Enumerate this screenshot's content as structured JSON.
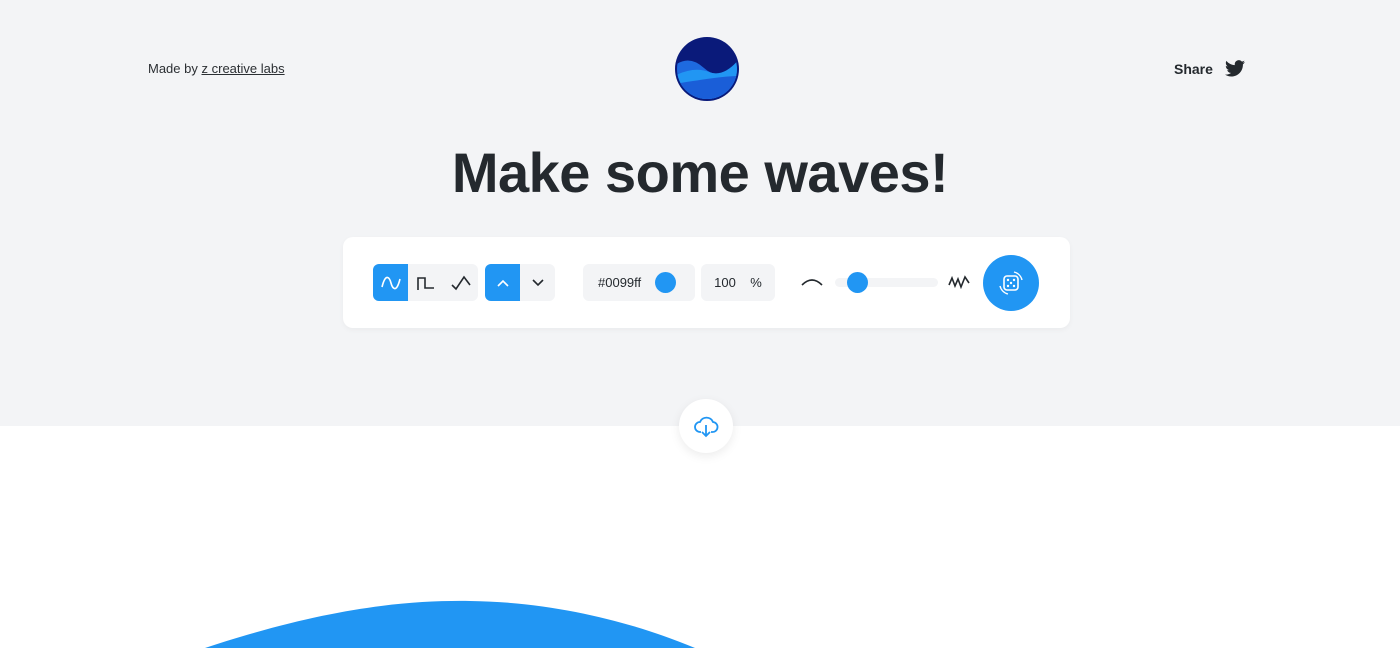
{
  "header": {
    "made_by_prefix": "Made by",
    "made_by_link": "z creative labs",
    "share_label": "Share"
  },
  "title": "Make some waves!",
  "toolbar": {
    "wave_types": [
      {
        "icon": "sine-wave-icon",
        "active": true
      },
      {
        "icon": "square-wave-icon",
        "active": false
      },
      {
        "icon": "triangle-wave-icon",
        "active": false
      }
    ],
    "direction": [
      {
        "icon": "chevron-up-icon",
        "active": true
      },
      {
        "icon": "chevron-down-icon",
        "active": false
      }
    ],
    "color_value": "#0099ff",
    "opacity_value": "100",
    "opacity_unit": "%",
    "complexity_level_percent": 15,
    "accent": "#2196f3"
  }
}
